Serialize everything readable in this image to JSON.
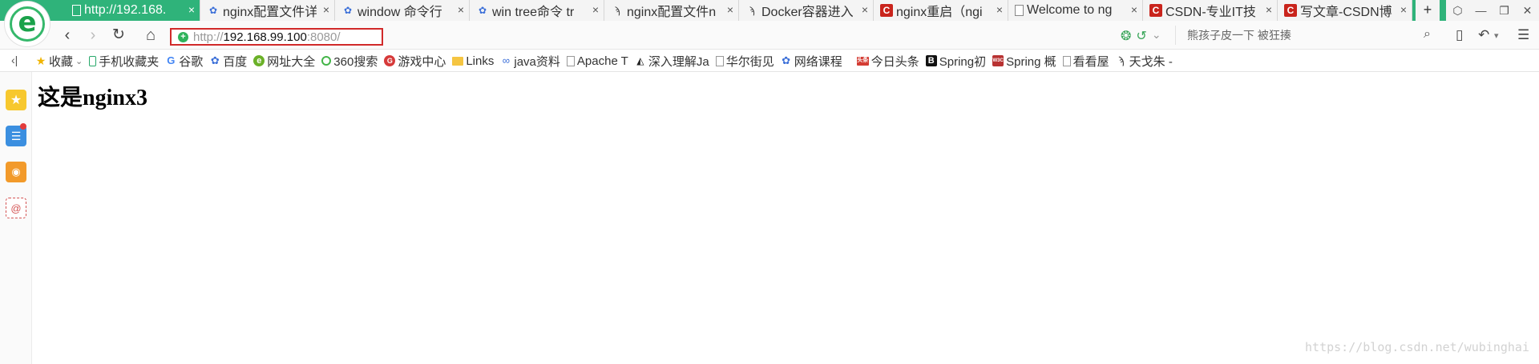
{
  "tabs": [
    {
      "icon": "page-icon",
      "title": "http://192.168.",
      "active": true
    },
    {
      "icon": "paw-icon",
      "title": "nginx配置文件详"
    },
    {
      "icon": "paw-icon",
      "title": "window 命令行"
    },
    {
      "icon": "paw-icon",
      "title": "win tree命令 tr"
    },
    {
      "icon": "fish-icon",
      "title": "nginx配置文件n"
    },
    {
      "icon": "fish-icon",
      "title": "Docker容器进入"
    },
    {
      "icon": "csdn-icon",
      "title": "nginx重启（ngi"
    },
    {
      "icon": "page-icon",
      "title": "Welcome to ng"
    },
    {
      "icon": "csdn-icon",
      "title": "CSDN-专业IT技"
    },
    {
      "icon": "csdn-icon",
      "title": "写文章-CSDN博"
    }
  ],
  "tab_close_glyph": "×",
  "new_tab_glyph": "+",
  "window_buttons": [
    "⬡",
    "—",
    "❐",
    "✕"
  ],
  "nav": {
    "back": "‹",
    "forward": "›",
    "reload": "↻",
    "home": "⌂",
    "url_scheme": "http://",
    "url_host": "192.168.99.100",
    "url_rest": ":8080/",
    "search_placeholder": "熊孩子皮一下 被狂揍",
    "search_glyph": "⌕"
  },
  "bookmarks": [
    {
      "icon": "star-icon",
      "label": "收藏",
      "glyph": "★",
      "dropdown": "⌄"
    },
    {
      "icon": "phone-icon",
      "label": "手机收藏夹",
      "glyph": ""
    },
    {
      "icon": "google-icon",
      "label": "谷歌",
      "glyph": "G"
    },
    {
      "icon": "paw-icon",
      "label": "百度",
      "glyph": "✿"
    },
    {
      "icon": "hao123-icon",
      "label": "网址大全",
      "glyph": "e"
    },
    {
      "icon": "360-icon",
      "label": "360搜索",
      "glyph": ""
    },
    {
      "icon": "game-icon",
      "label": "游戏中心",
      "glyph": "G"
    },
    {
      "icon": "folder-icon",
      "label": "Links",
      "glyph": ""
    },
    {
      "icon": "link-icon",
      "label": "java资料",
      "glyph": "∞"
    },
    {
      "icon": "page-icon",
      "label": "Apache T",
      "glyph": ""
    },
    {
      "icon": "tux-icon",
      "label": "深入理解Ja",
      "glyph": "◭"
    },
    {
      "icon": "page-icon",
      "label": "华尔街见",
      "glyph": ""
    },
    {
      "icon": "paw-icon",
      "label": "网络课程",
      "glyph": "✿"
    },
    {
      "icon": "toutiao-icon",
      "label": "今日头条",
      "glyph": "头条"
    },
    {
      "icon": "b-icon",
      "label": "Spring初",
      "glyph": "B"
    },
    {
      "icon": "spring-icon",
      "label": "Spring 概",
      "glyph": "W3C"
    },
    {
      "icon": "page-icon",
      "label": "看看屋",
      "glyph": ""
    },
    {
      "icon": "fish-icon",
      "label": "天戈朱 -",
      "glyph": "ϡ"
    }
  ],
  "bookmarks_toggle": "‹|",
  "sidebar": {
    "fav_glyph": "★",
    "news_glyph": "☰",
    "weibo_glyph": "◉",
    "mail_glyph": "@"
  },
  "page": {
    "heading_prefix": "这是",
    "heading_name": "nginx3"
  },
  "watermark": "https://blog.csdn.net/wubinghai"
}
